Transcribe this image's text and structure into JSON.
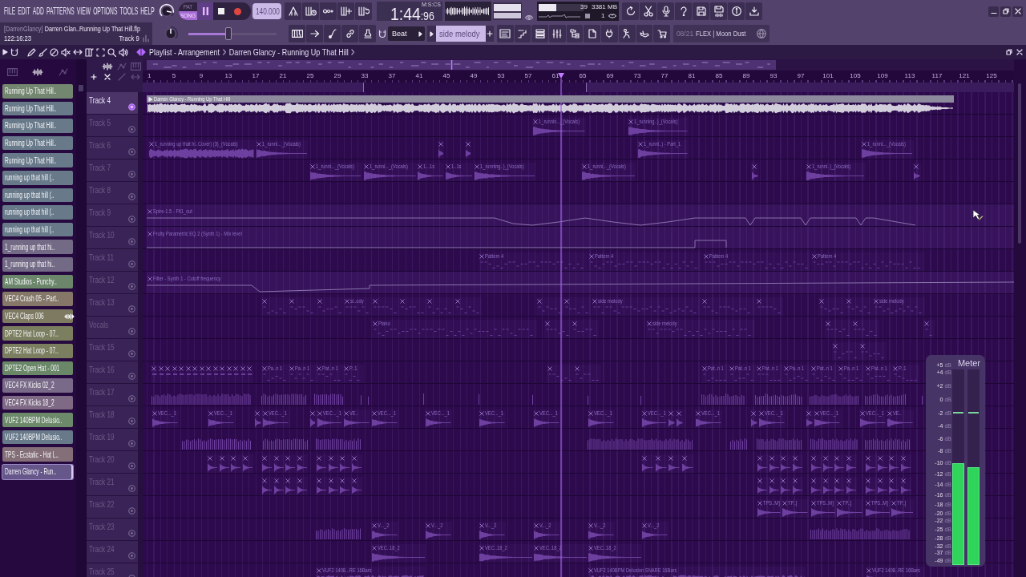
{
  "menu": [
    "FILE",
    "EDIT",
    "ADD",
    "PATTERNS",
    "VIEW",
    "OPTIONS",
    "TOOLS",
    "HELP"
  ],
  "master_volume": {
    "level": 0.88
  },
  "transport": {
    "modes": [
      {
        "label": "PAT",
        "selected": false
      },
      {
        "label": "SONG",
        "selected": true
      }
    ],
    "playing": true
  },
  "tempo": "140.000",
  "song_time": {
    "unit": "M:S:CS",
    "main": "1:44",
    "fraction": ":96"
  },
  "monitor": {
    "cpu": {
      "level": 0.39
    },
    "cpu_value": "39",
    "memory": "3381 MB",
    "polyphony": "1"
  },
  "hint": {
    "user": "[DarrenGlancy]",
    "file": "Darren Glan..Running Up That Hill.flp",
    "time": "122:16:23",
    "track": "Track 9"
  },
  "master_pitch": {
    "level": 0.5
  },
  "song_position": {
    "level": 0.45
  },
  "snap": "Beat",
  "pattern": "side melody",
  "news": {
    "date": "08/21",
    "title": "FLEX | Moon Dust"
  },
  "playlist": {
    "title": "Playlist - Arrangement",
    "arrangement": "Darren Glancy - Running Up That Hill",
    "picker_tabs": [
      {
        "kind": "patterns",
        "selected": false
      },
      {
        "kind": "audio",
        "selected": true
      },
      {
        "kind": "automation",
        "selected": false
      }
    ],
    "picker": [
      {
        "label": "Running Up That Hill..",
        "color": "#73866f",
        "selected": false
      },
      {
        "label": "Running Up That Hill..",
        "color": "#687a8a",
        "selected": false
      },
      {
        "label": "Running Up That Hill..",
        "color": "#687a8a",
        "selected": false
      },
      {
        "label": "Running Up That Hill..",
        "color": "#687a8a",
        "selected": false
      },
      {
        "label": "Running Up That Hill..",
        "color": "#687a8a",
        "selected": false
      },
      {
        "label": "running up that hill (..",
        "color": "#687a8a",
        "selected": false
      },
      {
        "label": "running up that hill (..",
        "color": "#687a8a",
        "selected": false
      },
      {
        "label": "running up that hill (..",
        "color": "#687a8a",
        "selected": false
      },
      {
        "label": "running up that hill (..",
        "color": "#687a8a",
        "selected": false
      },
      {
        "label": "1_running up that hi..",
        "color": "#736a86",
        "selected": false
      },
      {
        "label": "1_running up that hi..",
        "color": "#736a86",
        "selected": false
      },
      {
        "label": "AM Studios - Punchy..",
        "color": "#6b866a",
        "selected": false
      },
      {
        "label": "VEC4 Crash 05 - Part..",
        "color": "#857869",
        "selected": false
      },
      {
        "label": "VEC4 Claps 006",
        "color": "#7e7a62",
        "selected": false
      },
      {
        "label": "DPTE2 Hat Loop - 07..",
        "color": "#7b7f60",
        "selected": false
      },
      {
        "label": "DPTE2 Hat Loop - 07..",
        "color": "#7b7f60",
        "selected": false
      },
      {
        "label": "DPTE2 Open Hat - 001",
        "color": "#6a8868",
        "selected": false
      },
      {
        "label": "VEC4 FX Kicks 02_2",
        "color": "#786a88",
        "selected": false
      },
      {
        "label": "VEC4 FX Kicks 18_2",
        "color": "#7f6a86",
        "selected": false
      },
      {
        "label": "VUF2 140BPM Delusio..",
        "color": "#6c8a6a",
        "selected": false
      },
      {
        "label": "VUF2 140BPM Delusio..",
        "color": "#687a8a",
        "selected": false
      },
      {
        "label": "TPS - Ecstatic - Hat L..",
        "color": "#846e78",
        "selected": false
      },
      {
        "label": "Darren Glancy - Run..",
        "color": "#65578a",
        "selected": true
      }
    ],
    "ruler": [
      "1",
      "5",
      "9",
      "13",
      "17",
      "21",
      "25",
      "29",
      "33",
      "37",
      "41",
      "45",
      "49",
      "53",
      "57",
      "61",
      "65",
      "69",
      "73",
      "77",
      "81",
      "85",
      "89",
      "93",
      "97",
      "101",
      "105",
      "109",
      "113",
      "117",
      "121",
      "125"
    ],
    "position": {
      "level": 0.48
    },
    "tracks": [
      {
        "name": "Track 4",
        "muted": false,
        "clips": [
          {
            "kind": "audio",
            "label": "Darren Glancy - Running Up That Hill"
          }
        ]
      },
      {
        "name": "Track 5",
        "muted": true,
        "clips": [
          {
            "kind": "audio",
            "label": "1_runnin..._(Vocals)"
          },
          {
            "kind": "audio",
            "label": "1_running..)_(Vocals)"
          }
        ]
      },
      {
        "name": "Track 6",
        "muted": true,
        "clips": [
          {
            "kind": "audio",
            "label": "1_running up that hi..Cover) (3)_(Vocals)"
          },
          {
            "kind": "audio",
            "label": "1_runni..._(Vocals)"
          },
          {
            "kind": "audio"
          },
          {
            "kind": "audio"
          },
          {
            "kind": "audio",
            "label": "1_runni..) - Part_1"
          },
          {
            "kind": "audio",
            "label": "1_runni..._(Vocals)"
          }
        ]
      },
      {
        "name": "Track 7",
        "muted": true,
        "clips": [
          {
            "kind": "audio",
            "label": "1_runni..._(Vocals)"
          },
          {
            "kind": "audio",
            "label": "1_runni..._(Vocals)"
          },
          {
            "kind": "audio",
            "label": "1...1s"
          },
          {
            "kind": "audio",
            "label": "1..1s"
          },
          {
            "kind": "audio",
            "label": "1_running..)_(Vocals)"
          },
          {
            "kind": "audio",
            "label": "1_runni..._(Vocals)"
          },
          {
            "kind": "audio"
          },
          {
            "kind": "audio",
            "label": "1_runni..)_(Vocals)"
          },
          {
            "kind": "audio"
          }
        ]
      },
      {
        "name": "Track 8",
        "muted": true
      },
      {
        "name": "Track 9",
        "muted": true,
        "clips": [
          {
            "kind": "automation",
            "label": "Spire-1.5 - Flt1_cut"
          }
        ]
      },
      {
        "name": "Track 10",
        "muted": true,
        "clips": [
          {
            "kind": "automation",
            "label": "Fruity Parametric EQ 2 (Synth 1) - Mix level"
          }
        ]
      },
      {
        "name": "Track 11",
        "muted": true,
        "clips": [
          {
            "kind": "pattern",
            "label": "Pattern 4"
          },
          {
            "kind": "pattern",
            "label": "Pattern 4"
          },
          {
            "kind": "pattern",
            "label": "Pattern 4"
          },
          {
            "kind": "pattern",
            "label": "Pattern 4"
          }
        ]
      },
      {
        "name": "Track 12",
        "muted": true,
        "clips": [
          {
            "kind": "automation",
            "label": "Filter - Synth 1 - Cutoff frequency"
          }
        ]
      },
      {
        "name": "Track 13",
        "muted": true,
        "clips": [
          {
            "kind": "pattern"
          },
          {
            "kind": "pattern"
          },
          {
            "kind": "pattern"
          },
          {
            "kind": "pattern",
            "label": "si..ody"
          },
          {
            "kind": "pattern"
          },
          {
            "kind": "pattern"
          },
          {
            "kind": "pattern"
          },
          {
            "kind": "pattern"
          },
          {
            "kind": "pattern"
          },
          {
            "kind": "pattern"
          },
          {
            "kind": "pattern",
            "label": "side melody"
          },
          {
            "kind": "pattern"
          },
          {
            "kind": "pattern"
          },
          {
            "kind": "pattern"
          },
          {
            "kind": "pattern"
          },
          {
            "kind": "pattern",
            "label": "side melody"
          }
        ]
      },
      {
        "name": "Vocals",
        "muted": true,
        "clips": [
          {
            "kind": "pattern",
            "label": "Piano"
          },
          {
            "kind": "pattern"
          },
          {
            "kind": "pattern"
          },
          {
            "kind": "pattern",
            "label": "side melody"
          },
          {
            "kind": "pattern"
          },
          {
            "kind": "pattern"
          },
          {
            "kind": "pattern"
          }
        ]
      },
      {
        "name": "Track 15",
        "muted": true,
        "clips": [
          {
            "kind": "pattern"
          },
          {
            "kind": "pattern"
          }
        ]
      },
      {
        "name": "Track 16",
        "muted": true,
        "clips": [
          {
            "kind": "pattern"
          },
          {
            "kind": "pattern"
          },
          {
            "kind": "pattern"
          },
          {
            "kind": "pattern"
          },
          {
            "kind": "pattern"
          },
          {
            "kind": "pattern"
          },
          {
            "kind": "pattern"
          },
          {
            "kind": "pattern"
          },
          {
            "kind": "pattern"
          },
          {
            "kind": "pattern"
          },
          {
            "kind": "pattern"
          },
          {
            "kind": "pattern"
          },
          {
            "kind": "pattern"
          },
          {
            "kind": "pattern"
          },
          {
            "kind": "pattern"
          },
          {
            "kind": "pattern",
            "label": "Pa..n 1"
          },
          {
            "kind": "pattern",
            "label": "Pa..n 1"
          },
          {
            "kind": "pattern",
            "label": "Pat..n 1"
          },
          {
            "kind": "pattern",
            "label": "P..1"
          },
          {
            "kind": "pattern"
          },
          {
            "kind": "pattern"
          },
          {
            "kind": "pattern",
            "label": "Pat..n 1"
          },
          {
            "kind": "pattern",
            "label": "Pat..n 1"
          },
          {
            "kind": "pattern",
            "label": "Pat..n 1"
          },
          {
            "kind": "pattern",
            "label": "Pa..n 1"
          },
          {
            "kind": "pattern",
            "label": "Pat..n 1"
          },
          {
            "kind": "pattern",
            "label": "Pa..n 1"
          },
          {
            "kind": "pattern",
            "label": "Pat..n 1"
          },
          {
            "kind": "pattern",
            "label": "P..1"
          }
        ]
      },
      {
        "name": "Track 17",
        "muted": true,
        "clips": [
          {
            "kind": "hits"
          },
          {
            "kind": "hits"
          },
          {
            "kind": "hits"
          },
          {
            "kind": "hits"
          },
          {
            "kind": "hits"
          },
          {
            "kind": "hits"
          },
          {
            "kind": "hits"
          },
          {
            "kind": "hits"
          },
          {
            "kind": "hits"
          },
          {
            "kind": "hits"
          },
          {
            "kind": "hits"
          },
          {
            "kind": "hits"
          },
          {
            "kind": "hits"
          },
          {
            "kind": "hits"
          },
          {
            "kind": "hits"
          }
        ]
      },
      {
        "name": "Track 18",
        "muted": true,
        "clips": [
          {
            "kind": "audio",
            "label": "VEC..._1"
          },
          {
            "kind": "audio",
            "label": "VEC..._1"
          },
          {
            "kind": "audio"
          },
          {
            "kind": "audio",
            "label": "VEC..._1"
          },
          {
            "kind": "audio"
          },
          {
            "kind": "audio",
            "label": "VEC..._1"
          },
          {
            "kind": "audio",
            "label": "VE.."
          },
          {
            "kind": "audio",
            "label": "VEC..._1"
          },
          {
            "kind": "audio",
            "label": "VEC..._1"
          },
          {
            "kind": "audio",
            "label": "VEC..._1"
          },
          {
            "kind": "audio",
            "label": "VEC..._1"
          },
          {
            "kind": "audio",
            "label": "VEC..._1"
          },
          {
            "kind": "audio",
            "label": "VEC..._1"
          },
          {
            "kind": "audio"
          },
          {
            "kind": "audio"
          },
          {
            "kind": "audio",
            "label": "VEC..._1"
          },
          {
            "kind": "audio"
          },
          {
            "kind": "audio",
            "label": "VEC..._1"
          },
          {
            "kind": "audio"
          },
          {
            "kind": "audio",
            "label": "VEC..._1"
          },
          {
            "kind": "audio",
            "label": "VEC..._1"
          },
          {
            "kind": "audio",
            "label": "VE.."
          }
        ]
      },
      {
        "name": "Track 19",
        "muted": true,
        "clips": [
          {
            "kind": "hits"
          },
          {
            "kind": "hits"
          },
          {
            "kind": "hits"
          },
          {
            "kind": "hits"
          },
          {
            "kind": "hits"
          },
          {
            "kind": "hits"
          },
          {
            "kind": "hits"
          },
          {
            "kind": "hits"
          }
        ]
      },
      {
        "name": "Track 20",
        "muted": true,
        "clips": [
          {
            "kind": "audio"
          },
          {
            "kind": "audio"
          },
          {
            "kind": "audio"
          },
          {
            "kind": "audio"
          },
          {
            "kind": "audio"
          },
          {
            "kind": "audio"
          },
          {
            "kind": "audio"
          },
          {
            "kind": "audio"
          },
          {
            "kind": "audio"
          },
          {
            "kind": "audio"
          },
          {
            "kind": "audio"
          },
          {
            "kind": "audio"
          },
          {
            "kind": "audio"
          },
          {
            "kind": "audio"
          },
          {
            "kind": "audio"
          },
          {
            "kind": "audio"
          },
          {
            "kind": "audio"
          },
          {
            "kind": "audio"
          },
          {
            "kind": "audio"
          },
          {
            "kind": "audio"
          },
          {
            "kind": "audio"
          },
          {
            "kind": "audio"
          },
          {
            "kind": "audio"
          },
          {
            "kind": "audio"
          },
          {
            "kind": "audio"
          },
          {
            "kind": "audio"
          },
          {
            "kind": "audio"
          },
          {
            "kind": "audio"
          }
        ]
      },
      {
        "name": "Track 21",
        "muted": true,
        "clips": [
          {
            "kind": "audio"
          },
          {
            "kind": "audio"
          },
          {
            "kind": "audio"
          },
          {
            "kind": "audio"
          },
          {
            "kind": "audio"
          },
          {
            "kind": "audio"
          },
          {
            "kind": "audio"
          },
          {
            "kind": "audio"
          },
          {
            "kind": "audio"
          },
          {
            "kind": "audio"
          },
          {
            "kind": "audio"
          },
          {
            "kind": "audio"
          },
          {
            "kind": "audio"
          },
          {
            "kind": "audio"
          },
          {
            "kind": "audio"
          },
          {
            "kind": "audio"
          },
          {
            "kind": "audio"
          },
          {
            "kind": "audio"
          },
          {
            "kind": "audio"
          },
          {
            "kind": "audio"
          }
        ]
      },
      {
        "name": "Track 22",
        "muted": true,
        "clips": [
          {
            "kind": "audio",
            "label": "TPS..M]"
          },
          {
            "kind": "audio",
            "label": "TP..]"
          },
          {
            "kind": "audio",
            "label": "TPS..M]"
          },
          {
            "kind": "audio",
            "label": "TP..]"
          },
          {
            "kind": "audio",
            "label": "TPS..M]"
          },
          {
            "kind": "audio",
            "label": "TP..]"
          }
        ]
      },
      {
        "name": "Track 23",
        "muted": true,
        "clips": [
          {
            "kind": "hits"
          },
          {
            "kind": "audio",
            "label": "V..._2"
          },
          {
            "kind": "audio",
            "label": "V..._2"
          },
          {
            "kind": "audio",
            "label": "V..._2"
          },
          {
            "kind": "audio",
            "label": "V..._2"
          },
          {
            "kind": "audio",
            "label": "V..._2"
          },
          {
            "kind": "audio",
            "label": "V..._2"
          },
          {
            "kind": "hits"
          }
        ]
      },
      {
        "name": "Track 24",
        "muted": true,
        "clips": [
          {
            "kind": "audio",
            "label": "VEC..18_2"
          },
          {
            "kind": "audio",
            "label": "VEC..18_2"
          },
          {
            "kind": "audio",
            "label": "VEC..18_2"
          },
          {
            "kind": "audio",
            "label": "VEC..18_2"
          }
        ]
      },
      {
        "name": "Track 25",
        "muted": true,
        "clips": [
          {
            "kind": "audio",
            "label": "VUF2 1408...RE 16Bars"
          },
          {
            "kind": "audio",
            "label": "VUF2 140BPM Delusion SNARE 16Bars"
          },
          {
            "kind": "audio",
            "label": "VUF2 1408..RE 16Bars"
          }
        ]
      }
    ]
  },
  "meter": {
    "title": "Meter",
    "scale": [
      {
        "value": "+5",
        "unit": "dB"
      },
      {
        "value": "+4",
        "unit": "dB"
      },
      {
        "value": "+2",
        "unit": "dB"
      },
      {
        "value": "0",
        "unit": "dB"
      },
      {
        "value": "-2",
        "unit": "dB"
      },
      {
        "value": "-4",
        "unit": "dB"
      },
      {
        "value": "-6",
        "unit": "dB"
      },
      {
        "value": "-8",
        "unit": "dB"
      },
      {
        "value": "-10",
        "unit": "dB"
      },
      {
        "value": "-12",
        "unit": "dB"
      },
      {
        "value": "-14",
        "unit": "dB"
      },
      {
        "value": "-16",
        "unit": "dB"
      },
      {
        "value": "-18",
        "unit": "dB"
      },
      {
        "value": "-20",
        "unit": "dB"
      },
      {
        "value": "-22",
        "unit": "dB"
      },
      {
        "value": "-25",
        "unit": "dB"
      },
      {
        "value": "-28",
        "unit": "dB"
      },
      {
        "value": "-32",
        "unit": "dB"
      },
      {
        "value": "-37",
        "unit": "dB"
      },
      {
        "value": "-49",
        "unit": "dB"
      }
    ],
    "channels": [
      {
        "level": 0.52,
        "peak": {
          "level": 0.78
        }
      },
      {
        "level": 0.5,
        "peak": {
          "level": 0.78
        }
      }
    ]
  }
}
